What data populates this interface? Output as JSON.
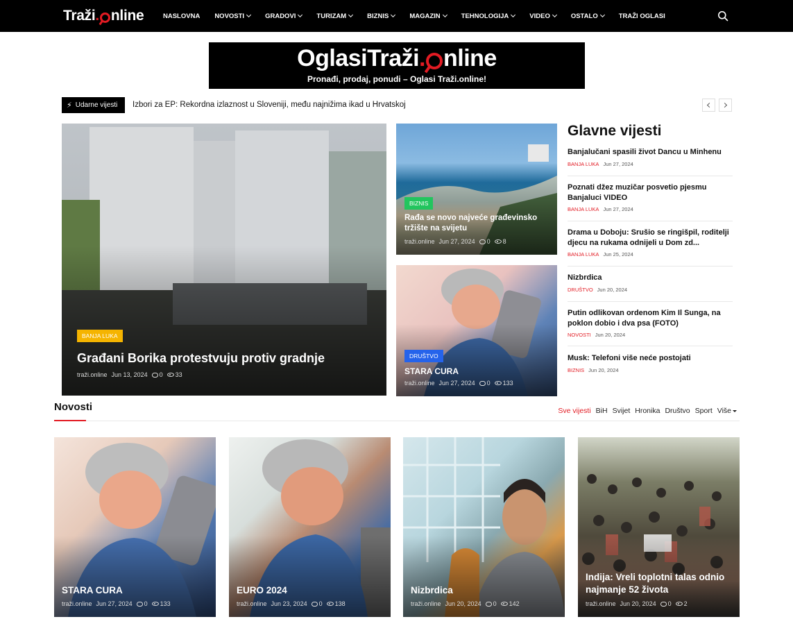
{
  "header": {
    "logo_left": "Traži",
    "logo_right": "nline",
    "menu": [
      {
        "label": "NASLOVNA",
        "dropdown": false
      },
      {
        "label": "NOVOSTI",
        "dropdown": true
      },
      {
        "label": "GRADOVI",
        "dropdown": true
      },
      {
        "label": "TURIZAM",
        "dropdown": true
      },
      {
        "label": "BIZNIS",
        "dropdown": true
      },
      {
        "label": "MAGAZIN",
        "dropdown": true
      },
      {
        "label": "TEHNOLOGIJA",
        "dropdown": true
      },
      {
        "label": "VIDEO",
        "dropdown": true
      },
      {
        "label": "OSTALO",
        "dropdown": true
      },
      {
        "label": "TRAŽI OGLASI",
        "dropdown": false
      }
    ],
    "search_icon": "search-icon"
  },
  "banner": {
    "logo_left": "OglasiTraži",
    "logo_right": "nline",
    "tagline": "Pronađi, prodaj, ponudi – Oglasi Traži.online!"
  },
  "ticker": {
    "label": "Udarne vijesti",
    "text": "Izbori za EP: Rekordna izlaznost u Sloveniji, među najnižima ikad u Hrvatskoj"
  },
  "featured": {
    "big": {
      "badge": "BANJA LUKA",
      "badge_color": "#f5b400",
      "title": "Građani Borika protestvuju protiv gradnje",
      "author": "traži.online",
      "date": "Jun 13, 2024",
      "comments": "0",
      "views": "33"
    },
    "top_right": {
      "badge": "BIZNIS",
      "badge_color": "#22c55e",
      "title": "Rađa se novo najveće građevinsko tržište na svijetu",
      "author": "traži.online",
      "date": "Jun 27, 2024",
      "comments": "0",
      "views": "8"
    },
    "bottom_right": {
      "badge": "DRUŠTVO",
      "badge_color": "#2563eb",
      "title": "STARA CURA",
      "author": "traži.online",
      "date": "Jun 27, 2024",
      "comments": "0",
      "views": "133"
    }
  },
  "main_news": {
    "title": "Glavne vijesti",
    "items": [
      {
        "title": "Banjalučani spasili život Dancu u Minhenu",
        "category": "BANJA LUKA",
        "date": "Jun 27, 2024"
      },
      {
        "title": "Poznati džez muzičar posvetio pjesmu Banjaluci VIDEO",
        "category": "BANJA LUKA",
        "date": "Jun 27, 2024"
      },
      {
        "title": "Drama u Doboju: Srušio se ringišpil, roditelji djecu na rukama odnijeli u Dom zd...",
        "category": "BANJA LUKA",
        "date": "Jun 25, 2024"
      },
      {
        "title": "Nizbrdica",
        "category": "DRUŠTVO",
        "date": "Jun 20, 2024"
      },
      {
        "title": "Putin odlikovan ordenom Kim Il Sunga, na poklon dobio i dva psa (FOTO)",
        "category": "NOVOSTI",
        "date": "Jun 20, 2024"
      },
      {
        "title": "Musk: Telefoni više neće postojati",
        "category": "BIZNIS",
        "date": "Jun 20, 2024"
      }
    ]
  },
  "novosti": {
    "title": "Novosti",
    "filters": [
      "Sve vijesti",
      "BiH",
      "Svijet",
      "Hronika",
      "Društvo",
      "Sport"
    ],
    "more": "Više",
    "cards": [
      {
        "title": "STARA CURA",
        "author": "traži.online",
        "date": "Jun 27, 2024",
        "comments": "0",
        "views": "133"
      },
      {
        "title": "EURO 2024",
        "author": "traži.online",
        "date": "Jun 23, 2024",
        "comments": "0",
        "views": "138"
      },
      {
        "title": "Nizbrdica",
        "author": "traži.online",
        "date": "Jun 20, 2024",
        "comments": "0",
        "views": "142"
      },
      {
        "title": "Indija: Vreli toplotni talas odnio najmanje 52 života",
        "author": "traži.online",
        "date": "Jun 20, 2024",
        "comments": "0",
        "views": "2"
      }
    ]
  },
  "colors": {
    "accent": "#e21b23",
    "nav_bg": "#000000"
  }
}
